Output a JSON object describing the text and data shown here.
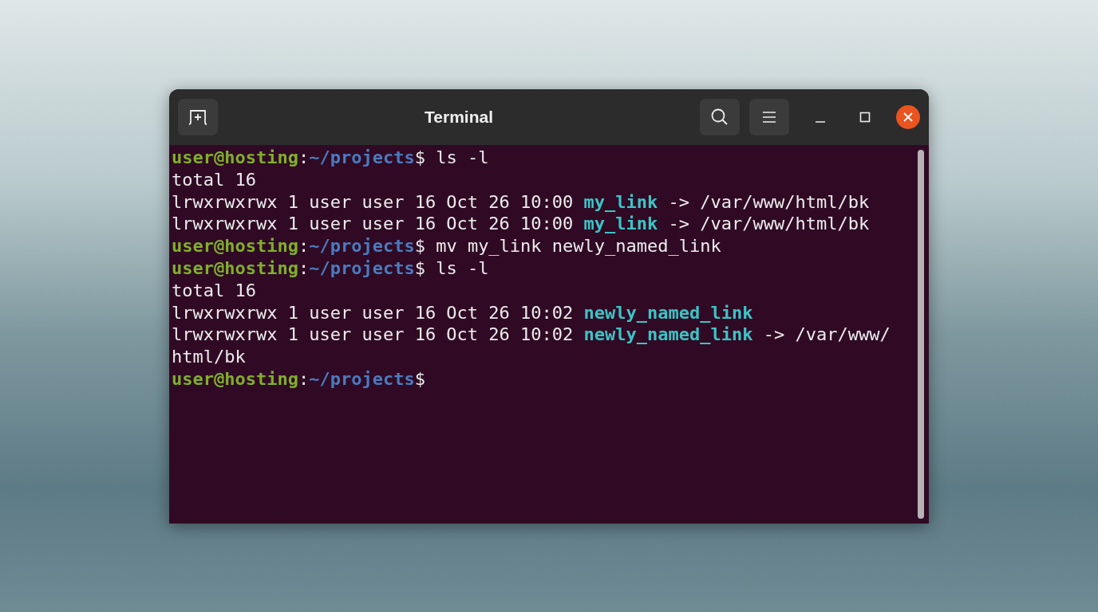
{
  "window": {
    "title": "Terminal"
  },
  "terminal": {
    "lines": [
      [
        {
          "kind": "user",
          "text": "user@hosting"
        },
        {
          "kind": "plain",
          "text": ":"
        },
        {
          "kind": "path",
          "text": "~/projects"
        },
        {
          "kind": "plain",
          "text": "$ ls -l"
        }
      ],
      [
        {
          "kind": "plain",
          "text": "total 16"
        }
      ],
      [
        {
          "kind": "plain",
          "text": "lrwxrwxrwx 1 user user 16 Oct 26 10:00 "
        },
        {
          "kind": "link",
          "text": "my_link"
        },
        {
          "kind": "plain",
          "text": " -> /var/www/html/bk"
        }
      ],
      [
        {
          "kind": "plain",
          "text": "lrwxrwxrwx 1 user user 16 Oct 26 10:00 "
        },
        {
          "kind": "link",
          "text": "my_link"
        },
        {
          "kind": "plain",
          "text": " -> /var/www/html/bk"
        }
      ],
      [
        {
          "kind": "user",
          "text": "user@hosting"
        },
        {
          "kind": "plain",
          "text": ":"
        },
        {
          "kind": "path",
          "text": "~/projects"
        },
        {
          "kind": "plain",
          "text": "$ mv my_link newly_named_link"
        }
      ],
      [
        {
          "kind": "user",
          "text": "user@hosting"
        },
        {
          "kind": "plain",
          "text": ":"
        },
        {
          "kind": "path",
          "text": "~/projects"
        },
        {
          "kind": "plain",
          "text": "$ ls -l"
        }
      ],
      [
        {
          "kind": "plain",
          "text": "total 16"
        }
      ],
      [
        {
          "kind": "plain",
          "text": "lrwxrwxrwx 1 user user 16 Oct 26 10:02 "
        },
        {
          "kind": "link",
          "text": "newly_named_link"
        }
      ],
      [
        {
          "kind": "plain",
          "text": "lrwxrwxrwx 1 user user 16 Oct 26 10:02 "
        },
        {
          "kind": "link",
          "text": "newly_named_link"
        },
        {
          "kind": "plain",
          "text": " -> /var/www/"
        }
      ],
      [
        {
          "kind": "plain",
          "text": "html/bk"
        }
      ],
      [
        {
          "kind": "user",
          "text": "user@hosting"
        },
        {
          "kind": "plain",
          "text": ":"
        },
        {
          "kind": "path",
          "text": "~/projects"
        },
        {
          "kind": "plain",
          "text": "$"
        }
      ]
    ]
  }
}
